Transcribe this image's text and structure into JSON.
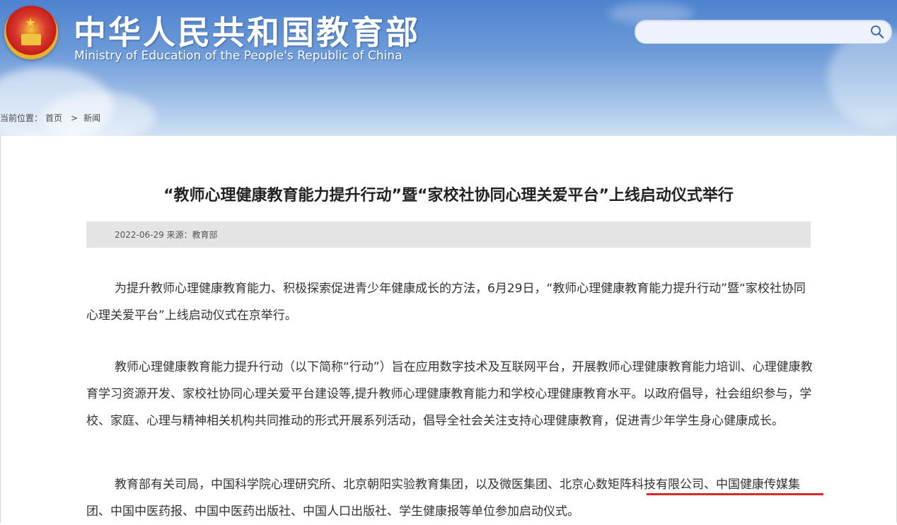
{
  "header": {
    "site_title": "中华人民共和国教育部",
    "site_subtitle": "Ministry of Education of the People's Republic of China",
    "search": {
      "value": "",
      "placeholder": ""
    }
  },
  "breadcrumb": {
    "label": "当前位置：",
    "items": [
      "首页",
      "新闻"
    ],
    "separator": ">"
  },
  "article": {
    "title": "“教师心理健康教育能力提升行动”暨“家校社协同心理关爱平台”上线启动仪式举行",
    "meta": "2022-06-29   来源：教育部",
    "paragraphs": [
      "为提升教师心理健康教育能力、积极探索促进青少年健康成长的方法，6月29日，“教师心理健康教育能力提升行动”暨“家校社协同心理关爱平台”上线启动仪式在京举行。",
      "教师心理健康教育能力提升行动（以下简称“行动”）旨在应用数字技术及互联网平台，开展教师心理健康教育能力培训、心理健康教育学习资源开发、家校社协同心理关爱平台建设等,提升教师心理健康教育能力和学校心理健康教育水平。以政府倡导，社会组织参与，学校、家庭、心理与精神相关机构共同推动的形式开展系列活动，倡导全社会关注支持心理健康教育，促进青少年学生身心健康成长。",
      "教育部有关司局，中国科学院心理研究所、北京朝阳实验教育集团，以及微医集团、北京心数矩阵科技有限公司、中国健康传媒集团、中国中医药报、中国中医药出版社、中国人口出版社、学生健康报等单位参加启动仪式。"
    ]
  },
  "colors": {
    "header_top": "#4f83cf",
    "header_bottom": "#cfe0f3",
    "highlight_underline": "#d62a2a",
    "meta_bar": "#e4e4e4"
  },
  "icons": {
    "search": "magnifier-icon",
    "emblem": "national-emblem"
  }
}
